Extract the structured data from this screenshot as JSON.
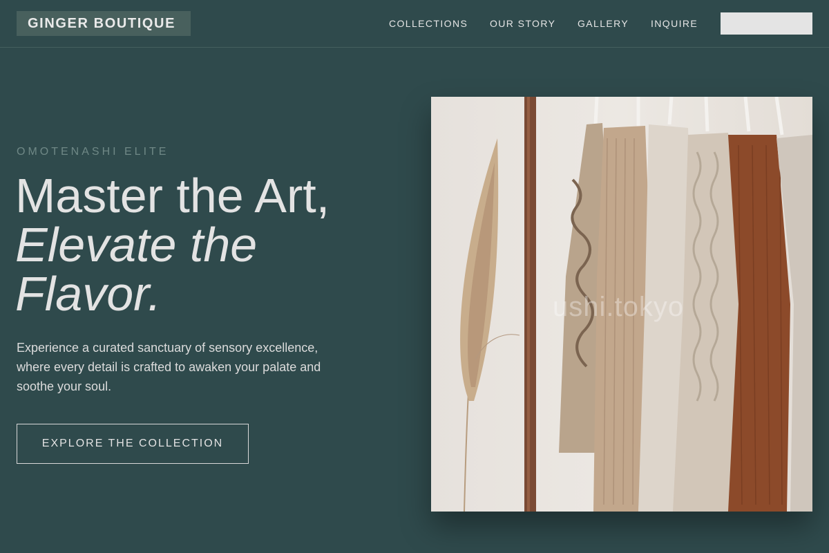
{
  "brand": {
    "name": "GINGER BOUTIQUE"
  },
  "nav": {
    "links": [
      "COLLECTIONS",
      "OUR STORY",
      "GALLERY",
      "INQUIRE"
    ],
    "cta_label": ""
  },
  "hero": {
    "eyebrow": "OMOTENASHI ELITE",
    "headline_line1": "Master the Art,",
    "headline_line2": "Elevate the",
    "headline_line3": "Flavor.",
    "lede": "Experience a curated sanctuary of sensory excellence, where every detail is crafted to awaken your palate and soothe your soul.",
    "cta_label": "EXPLORE THE COLLECTION",
    "image": {
      "subject": "clothing rack with knit sweaters and pampas grass",
      "watermark": "ushi.tokyo"
    }
  },
  "colors": {
    "background": "#2f4a4c",
    "logo_bg": "#48605d",
    "text": "#e6e6e6",
    "muted": "#6f8886",
    "nav_cta_bg": "#e4e4e4"
  }
}
